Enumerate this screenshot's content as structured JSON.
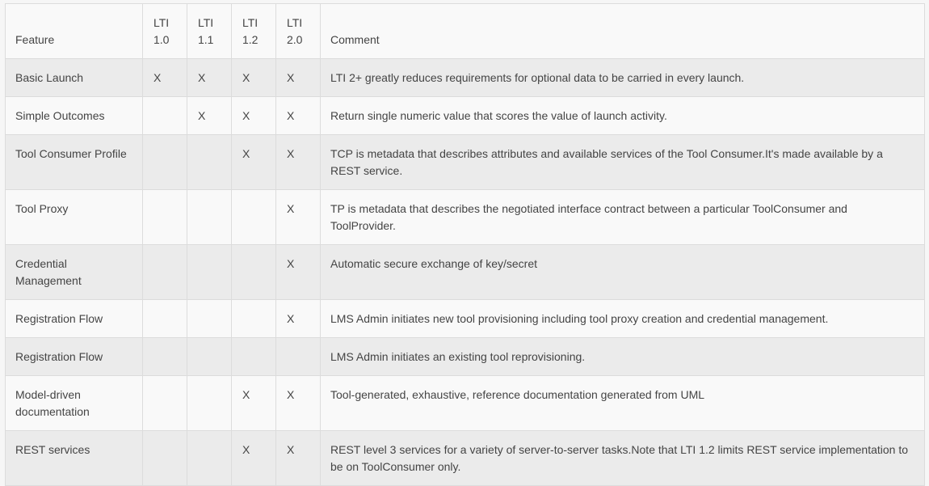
{
  "table": {
    "headers": {
      "feature": "Feature",
      "versions": [
        {
          "line1": "LTI",
          "line2": "1.0"
        },
        {
          "line1": "LTI",
          "line2": "1.1"
        },
        {
          "line1": "LTI",
          "line2": "1.2"
        },
        {
          "line1": "LTI",
          "line2": "2.0"
        }
      ],
      "comment": "Comment"
    },
    "rows": [
      {
        "feature": "Basic Launch",
        "marks": [
          "X",
          "X",
          "X",
          "X"
        ],
        "comment": "LTI 2+ greatly reduces requirements for optional data to be carried in every launch."
      },
      {
        "feature": "Simple Outcomes",
        "marks": [
          "",
          "X",
          "X",
          "X"
        ],
        "comment": "Return single numeric value that scores the value of launch activity."
      },
      {
        "feature": "Tool Consumer Profile",
        "marks": [
          "",
          "",
          "X",
          "X"
        ],
        "comment": "TCP is metadata that describes attributes and available services of the Tool Consumer.It's made available by a REST service."
      },
      {
        "feature": "Tool Proxy",
        "marks": [
          "",
          "",
          "",
          "X"
        ],
        "comment": "TP is metadata that describes the negotiated interface contract between a particular ToolConsumer and ToolProvider."
      },
      {
        "feature": "Credential Management",
        "marks": [
          "",
          "",
          "",
          "X"
        ],
        "comment": "Automatic secure exchange of key/secret"
      },
      {
        "feature": "Registration Flow",
        "marks": [
          "",
          "",
          "",
          "X"
        ],
        "comment": "LMS Admin initiates new tool provisioning including tool proxy creation and credential management."
      },
      {
        "feature": "Registration Flow",
        "marks": [
          "",
          "",
          "",
          ""
        ],
        "comment": "LMS Admin initiates an existing tool reprovisioning."
      },
      {
        "feature": "Model-driven documentation",
        "marks": [
          "",
          "",
          "X",
          "X"
        ],
        "comment": "Tool-generated, exhaustive, reference documentation generated from UML"
      },
      {
        "feature": "REST services",
        "marks": [
          "",
          "",
          "X",
          "X"
        ],
        "comment": "REST level 3 services for a variety of server-to-server tasks.Note that LTI 1.2 limits REST service implementation to be on ToolConsumer only."
      }
    ]
  },
  "colors": {
    "text": "#444444",
    "row_light": "#f9f9f9",
    "row_dark": "#ebebeb",
    "border": "#dcdcdc"
  }
}
